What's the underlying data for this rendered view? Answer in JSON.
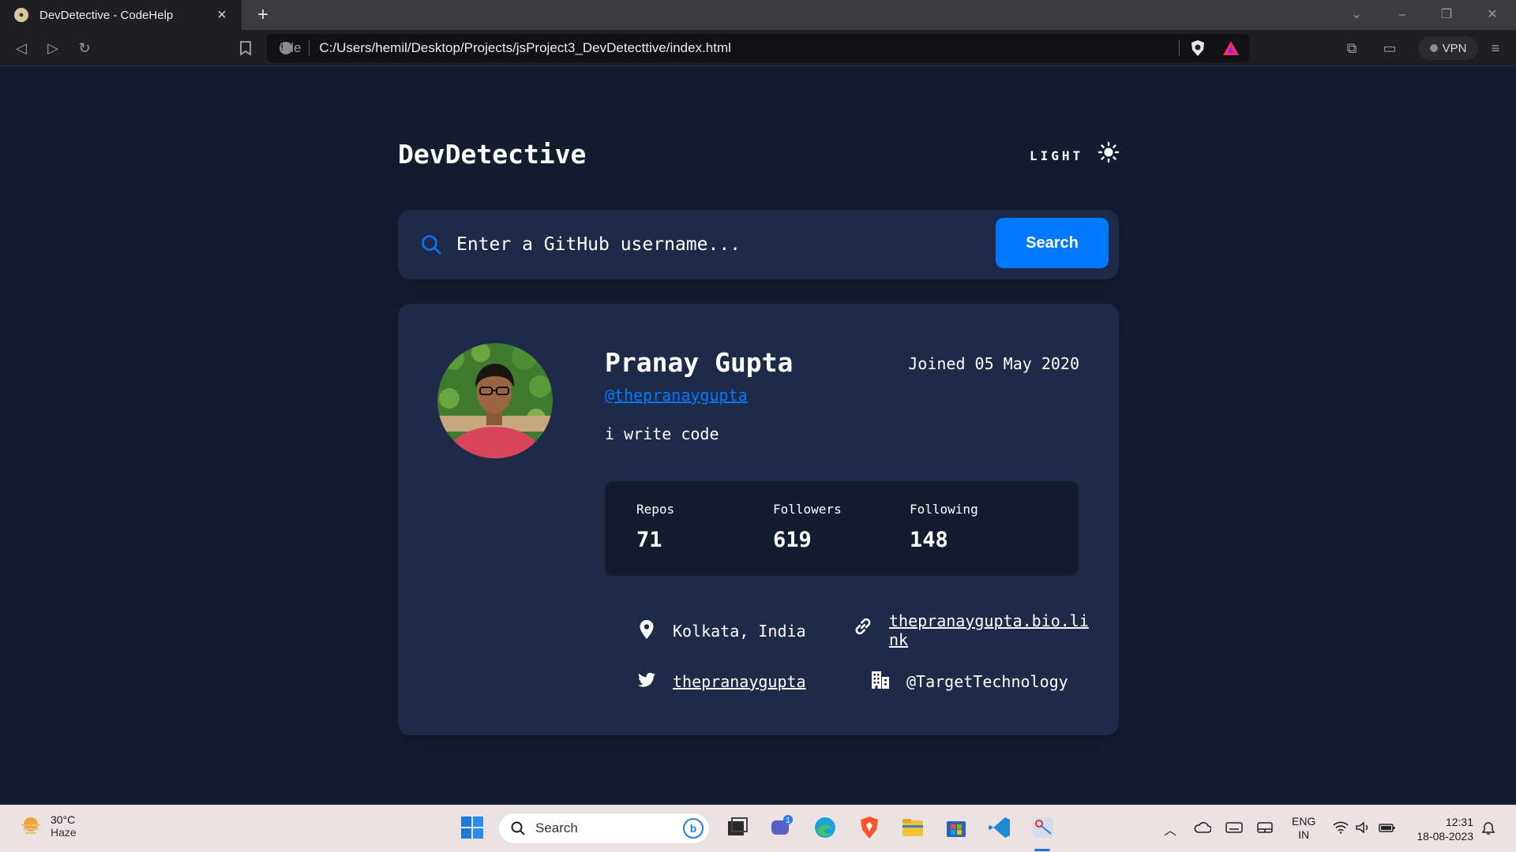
{
  "browser": {
    "tab_title": "DevDetective - CodeHelp",
    "url_scheme_label": "File",
    "url": "C:/Users/hemil/Desktop/Projects/jsProject3_DevDetecttive/index.html",
    "vpn_label": "VPN"
  },
  "app": {
    "logo": "DevDetective",
    "mode_label": "LIGHT",
    "search": {
      "placeholder": "Enter a GitHub username...",
      "button_label": "Search"
    },
    "profile": {
      "name": "Pranay Gupta",
      "joined": "Joined 05 May 2020",
      "handle": "@thepranaygupta",
      "bio": "i write code",
      "stats": [
        {
          "label": "Repos",
          "value": "71"
        },
        {
          "label": "Followers",
          "value": "619"
        },
        {
          "label": "Following",
          "value": "148"
        }
      ],
      "location": "Kolkata, India",
      "website_line1": "thepranaygupta.bio.li",
      "website_line2": "nk",
      "twitter": "thepranaygupta",
      "company": "@TargetTechnology"
    }
  },
  "taskbar": {
    "weather_temp": "30°C",
    "weather_cond": "Haze",
    "search_label": "Search",
    "chat_badge": "1",
    "lang_line1": "ENG",
    "lang_line2": "IN",
    "time": "12:31",
    "date": "18-08-2023"
  },
  "colors": {
    "bg": "#141c2f",
    "card": "#1e2a47",
    "accent": "#0079ff"
  }
}
